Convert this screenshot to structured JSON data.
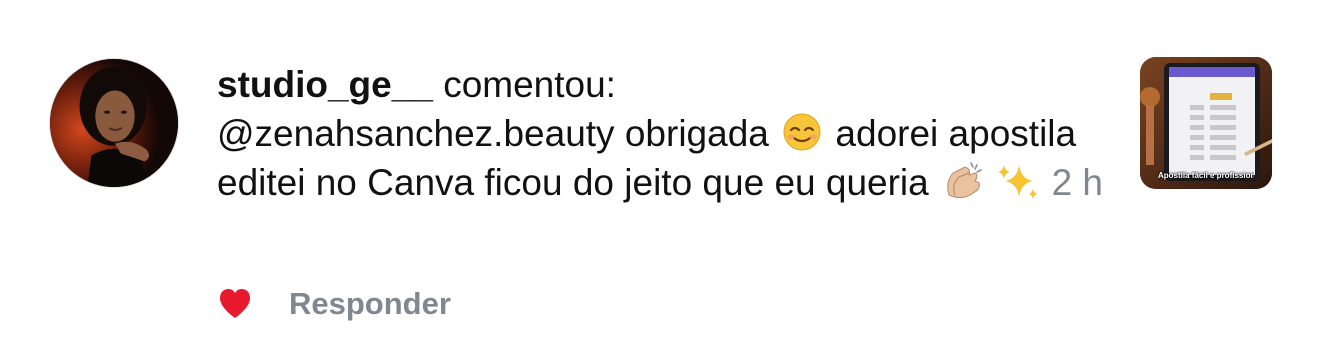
{
  "comment": {
    "username": "studio_ge__",
    "action": "comentou:",
    "mention": "@zenahsanchez.beauty",
    "text_part1": "obrigada",
    "emoji_1": "smiling-face-icon",
    "text_part2": "adorei apostila editei no Canva ficou do jeito que eu queria",
    "emoji_2": "clapping-hands-icon",
    "emoji_3": "sparkles-icon",
    "time": "2 h"
  },
  "actions": {
    "like_icon": "heart-icon",
    "like_color": "#e8192c",
    "reply_label": "Responder"
  },
  "thumbnail": {
    "caption": "Apostila fácil e profissional"
  },
  "colors": {
    "text": "#111111",
    "muted": "#7f8790",
    "background": "#ffffff"
  }
}
